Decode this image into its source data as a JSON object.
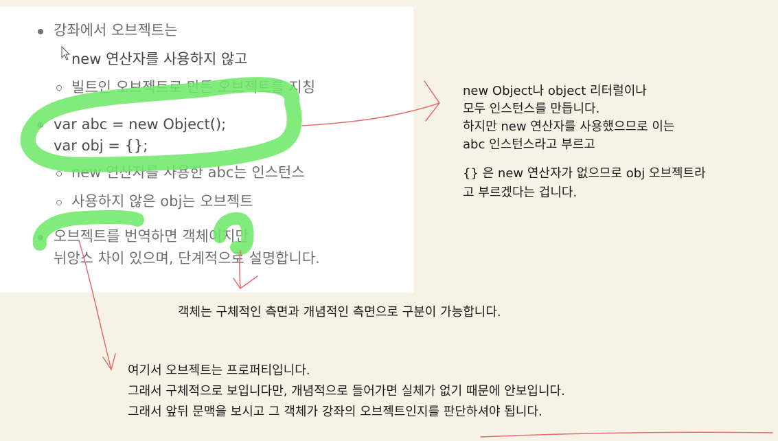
{
  "slide": {
    "bullet1": "강좌에서 오브젝트는",
    "bullet1_sub1": "new 연산자를 사용하지 않고",
    "bullet1_sub2": "빌트인 오브젝트로 만든 오브젝트를 지칭",
    "code_line1": "var abc = new Object();",
    "code_line2": "var obj = {};",
    "bullet2_sub1": "new 연산자를 사용한 abc는 인스턴스",
    "bullet2_sub2": "사용하지 않은 obj는 오브젝트",
    "bullet3_line1": "오브젝트를 번역하면 객체이지만",
    "bullet3_line2": "뉘앙스 차이 있으며, 단계적으로 설명합니다."
  },
  "notes": {
    "right": [
      "new Object나 object 리터럴이나",
      "모두 인스턴스를 만듭니다.",
      "하지만 new 연산자를 사용했으므로 이는",
      "abc 인스턴스라고 부르고",
      "{} 은 new 연산자가 없으므로 obj 오브젝트라",
      "고 부르겠다는 겁니다."
    ],
    "middle": "객체는 구체적인 측면과 개념적인 측면으로 구분이 가능합니다.",
    "bottom": [
      "여기서 오브젝트는 프로퍼티입니다.",
      "그래서 구체적으로 보입니다만, 개념적으로 들어가면 실체가 없기 때문에 안보입니다.",
      "그래서 앞뒤 문맥을 보시고 그 객체가 강좌의 오브젝트인지를 판단하셔야 됩니다."
    ]
  },
  "colors": {
    "highlight": "#6fe86a",
    "annotation_arrow": "#e86a6a",
    "background": "#f6f3e6"
  }
}
